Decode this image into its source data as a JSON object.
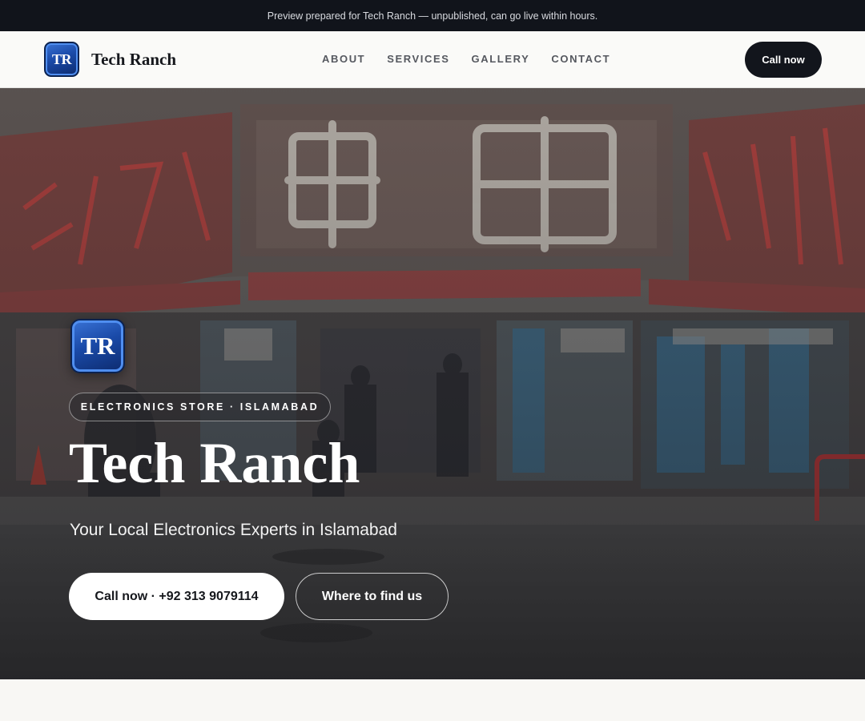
{
  "banner": {
    "text": "Preview prepared for Tech Ranch — unpublished, can go live within hours."
  },
  "header": {
    "logo_initials": "TR",
    "brand_name": "Tech Ranch",
    "nav": [
      {
        "label": "ABOUT"
      },
      {
        "label": "SERVICES"
      },
      {
        "label": "GALLERY"
      },
      {
        "label": "CONTACT"
      }
    ],
    "cta_label": "Call now"
  },
  "hero": {
    "logo_initials": "TR",
    "tag": "ELECTRONICS STORE · ISLAMABAD",
    "title": "Tech Ranch",
    "subtitle": "Your Local Electronics Experts in Islamabad",
    "primary_button": "Call now · +92 313 9079114",
    "secondary_button": "Where to find us",
    "background_image": "electronics storefront street scene with large red and cream neon signage"
  },
  "colors": {
    "banner_bg": "#11141b",
    "accent_dark": "#12151c",
    "logo_blue": "#1a4aa8",
    "page_bg": "#f8f7f4"
  }
}
